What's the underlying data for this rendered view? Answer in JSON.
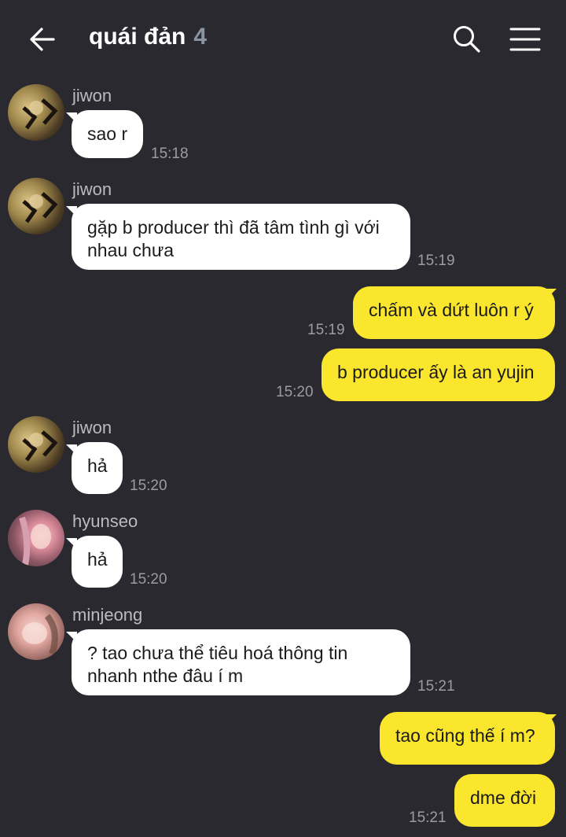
{
  "header": {
    "title": "quái đản",
    "member_count": "4"
  },
  "messages": [
    {
      "sender": "jiwon",
      "text": "sao r",
      "time": "15:18"
    },
    {
      "sender": "jiwon",
      "text_line1": "gặp b producer thì đã tâm tình gì với",
      "text_line2": "nhau chưa",
      "time": "15:19"
    },
    {
      "text": "chấm và dứt luôn r ý",
      "time": "15:19"
    },
    {
      "text": "b producer ấy là an yujin",
      "time": "15:20"
    },
    {
      "sender": "jiwon",
      "text": "hả",
      "time": "15:20"
    },
    {
      "sender": "hyunseo",
      "text": "hả",
      "time": "15:20"
    },
    {
      "sender": "minjeong",
      "text_line1": "? tao chưa thể tiêu hoá thông tin",
      "text_line2": "nhanh nthe đâu í m",
      "time": "15:21"
    },
    {
      "text": "tao cũng thế í m?",
      "time": ""
    },
    {
      "text": "dme đời",
      "time": "15:21"
    }
  ],
  "colors": {
    "background": "#2b2930",
    "incoming_bubble": "#ffffff",
    "outgoing_bubble": "#fbe62e"
  },
  "icons": [
    "back-arrow-icon",
    "search-icon",
    "menu-icon"
  ]
}
